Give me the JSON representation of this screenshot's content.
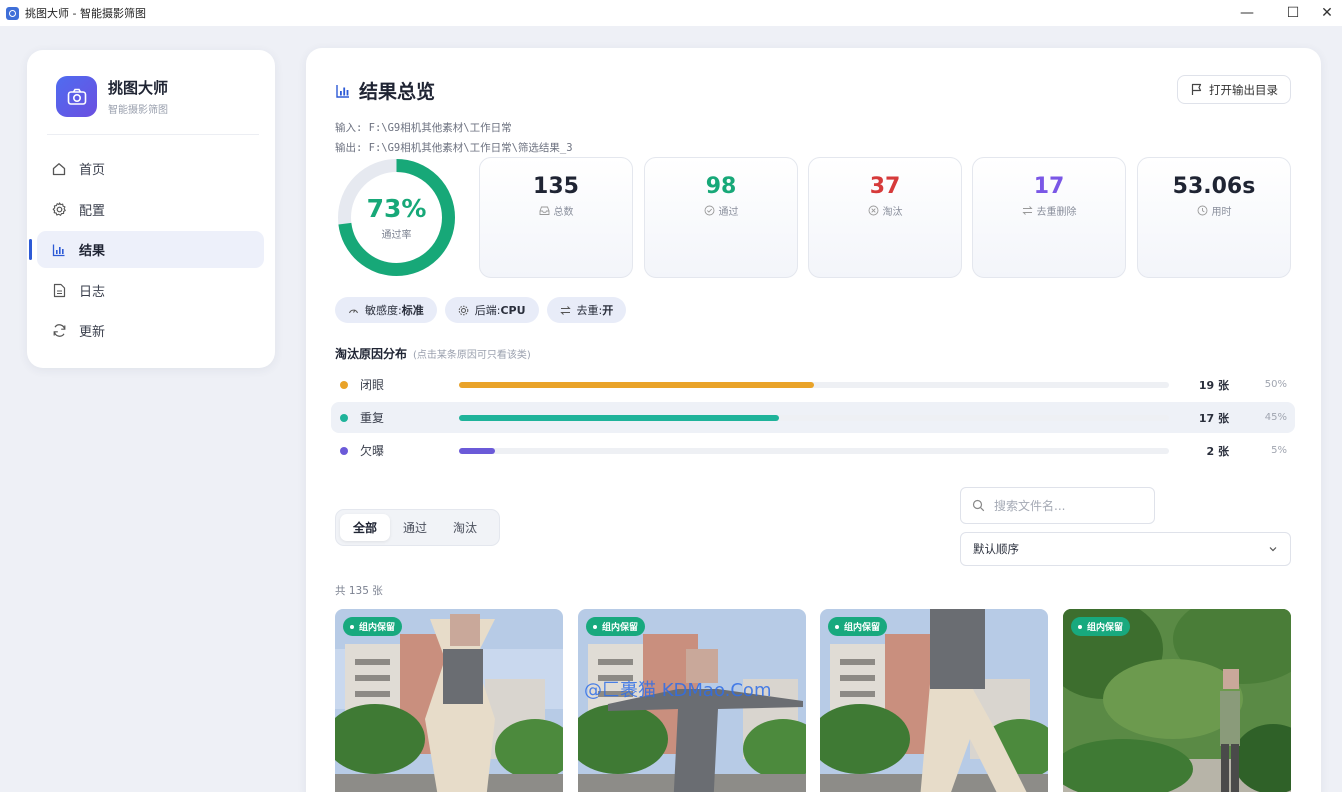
{
  "window": {
    "title": "挑图大师 - 智能摄影筛图",
    "min": "—",
    "max": "☐",
    "close": "✕"
  },
  "brand": {
    "name": "挑图大师",
    "subtitle": "智能摄影筛图",
    "icon": "camera-icon"
  },
  "nav": [
    {
      "label": "首页",
      "icon": "home-icon"
    },
    {
      "label": "配置",
      "icon": "gear-icon"
    },
    {
      "label": "结果",
      "icon": "bar-chart-icon",
      "active": true
    },
    {
      "label": "日志",
      "icon": "document-icon"
    },
    {
      "label": "更新",
      "icon": "refresh-icon"
    }
  ],
  "header": {
    "title": "结果总览",
    "open_dir": "打开输出目录"
  },
  "paths": {
    "input": "输入: F:\\G9相机其他素材\\工作日常",
    "output": "输出: F:\\G9相机其他素材\\工作日常\\筛选结果_3"
  },
  "pass_rate": {
    "value": "73%",
    "label": "通过率",
    "fraction": 0.73,
    "color": "#17a878"
  },
  "stats": [
    {
      "value": "135",
      "label": "总数",
      "color": "#1f2433",
      "icon": "inbox-icon"
    },
    {
      "value": "98",
      "label": "通过",
      "color": "#17a878",
      "icon": "check-circle-icon"
    },
    {
      "value": "37",
      "label": "淘汰",
      "color": "#d63a3a",
      "icon": "x-circle-icon"
    },
    {
      "value": "17",
      "label": "去重删除",
      "color": "#7a57e6",
      "icon": "swap-icon"
    },
    {
      "value": "53.06s",
      "label": "用时",
      "color": "#1f2433",
      "icon": "clock-icon"
    }
  ],
  "pills": [
    {
      "key": "敏感度:",
      "value": "标准",
      "icon": "gauge-icon"
    },
    {
      "key": "后端:",
      "value": "CPU",
      "icon": "chip-icon"
    },
    {
      "key": "去重:",
      "value": "开",
      "icon": "swap-icon"
    }
  ],
  "reasons": {
    "title": "淘汰原因分布",
    "hint": "(点击某条原因可只看该类)",
    "items": [
      {
        "name": "闭眼",
        "count": "19 张",
        "pct": "50%",
        "fraction": 0.5,
        "color": "#e9a329"
      },
      {
        "name": "重复",
        "count": "17 张",
        "pct": "45%",
        "fraction": 0.45,
        "color": "#1fb39a"
      },
      {
        "name": "欠曝",
        "count": "2 张",
        "pct": "5%",
        "fraction": 0.05,
        "color": "#6b5ad8"
      }
    ]
  },
  "filter_tabs": [
    {
      "label": "全部",
      "active": true
    },
    {
      "label": "通过"
    },
    {
      "label": "淘汰"
    }
  ],
  "search": {
    "placeholder": "搜索文件名..."
  },
  "sort": {
    "value": "默认顺序"
  },
  "total": "共 135 张",
  "photos": [
    {
      "badge": "组内保留",
      "scene": "jump-building"
    },
    {
      "badge": "组内保留",
      "scene": "jump-building"
    },
    {
      "badge": "组内保留",
      "scene": "jump-building"
    },
    {
      "badge": "组内保留",
      "scene": "garden"
    }
  ],
  "watermark": "@匚裹猫 KDMao.Com"
}
